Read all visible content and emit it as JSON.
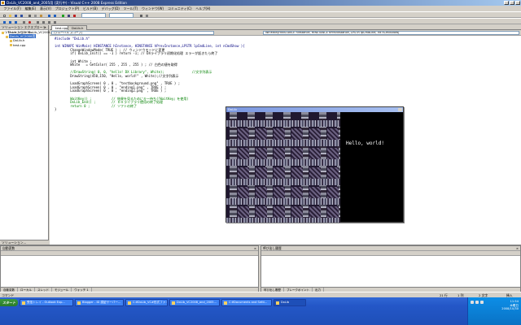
{
  "window": {
    "title": "DxLib_VC2008_and_2005用 (実行中) - Visual C++ 2008 Express Edition"
  },
  "menu": [
    "ファイル(F)",
    "編集(E)",
    "表示(V)",
    "プロジェクト(P)",
    "ビルド(B)",
    "デバッグ(D)",
    "ツール(T)",
    "ウィンドウ(W)",
    "コミュニティ(C)",
    "ヘルプ(H)"
  ],
  "solution_explorer": {
    "caption": "ソリューション エクスプローラー - DxLib_VC2008...",
    "items": [
      {
        "label": "ソリューション 'DxLib_VC2008' (1 プロジェクト)",
        "indent": 0,
        "selected": false
      },
      {
        "label": "DxLib_VC2008用",
        "indent": 1,
        "selected": true
      },
      {
        "label": "DxLib.h",
        "indent": 2,
        "selected": false
      },
      {
        "label": "test.cpp",
        "indent": 2,
        "selected": false
      }
    ],
    "bottom_tab": "ソリューション..."
  },
  "editor": {
    "tabs": [
      "test.cpp",
      "DxLib.h"
    ],
    "nav_left": "(グローバル スコープ)",
    "nav_right": "WinMain(HINSTANCE hInstance, HINSTANCE hPrevInstance, LPSTR lpCmdLine, int nCmdShow)",
    "lines": [
      {
        "text": "#include \"DxLib.h\"",
        "kind": "k"
      },
      {
        "text": "",
        "kind": ""
      },
      {
        "text": "int WINAPI WinMain( HINSTANCE hInstance, HINSTANCE hPrevInstance,LPSTR lpCmdLine, int nCmdShow ){",
        "kind": "k"
      },
      {
        "text": "        ChangeWindowMode( TRUE ) ; // ウィンドウモードに変更",
        "kind": ""
      },
      {
        "text": "        if( DxLib_Init() == -1 ) return -1; // DXライブラリ初期化処理 エラーが起きたら終了",
        "kind": ""
      },
      {
        "text": "",
        "kind": ""
      },
      {
        "text": "        int White ;",
        "kind": ""
      },
      {
        "text": "        White   = GetColor( 255 , 255 , 255 ) ; // 白色の値を取得",
        "kind": ""
      },
      {
        "text": "",
        "kind": ""
      },
      {
        "text": "        //DrawString( 0, 0, \"hello! DX Library\", White);              //文字列表示",
        "kind": "c"
      },
      {
        "text": "        DrawString(450,150, \"Hello, world!\" , White);//文字列表示",
        "kind": ""
      },
      {
        "text": "",
        "kind": ""
      },
      {
        "text": "        LoadGraphScreen( 0 , 0 , \"testbackground.png\" , TRUE ) ;",
        "kind": ""
      },
      {
        "text": "        LoadGraphScreen( 0 , 0 , \"ending1.png\" , TRUE ) ;",
        "kind": ""
      },
      {
        "text": "        LoadGraphScreen( 0 , 0 , \"ending2.png\" , TRUE ) ;",
        "kind": ""
      },
      {
        "text": "",
        "kind": ""
      },
      {
        "text": "        WaitKey() ;          // 結果を見るためにキー待ち(『WaitKey』を使用)",
        "kind": "c"
      },
      {
        "text": "        DxLib_End() ;        // ＤＸライブラリ使用の終了処理",
        "kind": "c"
      },
      {
        "text": "        return 0 ;           // ソフトの終了",
        "kind": "c"
      },
      {
        "text": "}",
        "kind": ""
      }
    ]
  },
  "console": {
    "title": "DxLib",
    "hello": "Hello, world!"
  },
  "bottom": {
    "left_caption": "自動変数",
    "left_tabs": [
      "自動変数",
      "ローカル",
      "スレッド",
      "モジュール",
      "ウォッチ 1"
    ],
    "right_caption": "呼び出し履歴",
    "right_tabs": [
      "呼び出し履歴",
      "ブレークポイント",
      "出力"
    ]
  },
  "status": {
    "text": "コマンド",
    "line": "21 行",
    "col": "1 列",
    "ch": "2 文字",
    "mode": "挿入"
  },
  "taskbar": {
    "start": "スタート",
    "tasks": [
      "受信トレイ - Outlook Exp...",
      "Blogger - ID 認証サーバー...",
      "C:¥DxLib_VC#形式ファイル",
      "DxLib_VC2008_and_2005...",
      "C:¥Documents and Setti...",
      "DxLib"
    ],
    "clock_time": "11:54",
    "clock_day": "木曜日",
    "clock_date": "2008/10/30"
  },
  "colors": {
    "title_grad_start": "#0a246a",
    "selection": "#316ac5",
    "taskbar": "#2457c7",
    "start_green": "#3c9a3c"
  }
}
